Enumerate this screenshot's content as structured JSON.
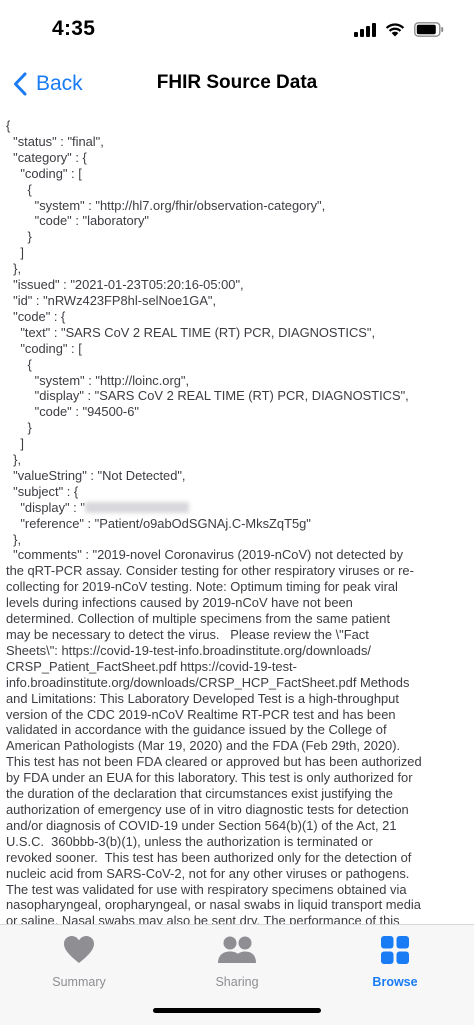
{
  "status_bar": {
    "time": "4:35"
  },
  "nav": {
    "back_label": "Back",
    "title": "FHIR Source Data"
  },
  "json_lines": [
    "{",
    "  \"status\" : \"final\",",
    "  \"category\" : {",
    "    \"coding\" : [",
    "      {",
    "        \"system\" : \"http://hl7.org/fhir/observation-category\",",
    "        \"code\" : \"laboratory\"",
    "      }",
    "    ]",
    "  },",
    "  \"issued\" : \"2021-01-23T05:20:16-05:00\",",
    "  \"id\" : \"nRWz423FP8hl-selNoe1GA\",",
    "  \"code\" : {",
    "    \"text\" : \"SARS CoV 2 REAL TIME (RT) PCR, DIAGNOSTICS\",",
    "    \"coding\" : [",
    "      {",
    "        \"system\" : \"http://loinc.org\",",
    "        \"display\" : \"SARS CoV 2 REAL TIME (RT) PCR, DIAGNOSTICS\",",
    "        \"code\" : \"94500-6\"",
    "      }",
    "    ]",
    "  },",
    "  \"valueString\" : \"Not Detected\",",
    "  \"subject\" : {"
  ],
  "subject_display_prefix": "    \"display\" : \"",
  "json_lines_after": [
    "    \"reference\" : \"Patient/o9abOdSGNAj.C-MksZqT5g\"",
    "  },"
  ],
  "comments_lines": [
    "  \"comments\" : \"2019-novel Coronavirus (2019-nCoV) not detected by",
    "the qRT-PCR assay. Consider testing for other respiratory viruses or re-",
    "collecting for 2019-nCoV testing. Note: Optimum timing for peak viral",
    "levels during infections caused by 2019-nCoV have not been",
    "determined. Collection of multiple specimens from the same patient",
    "may be necessary to detect the virus.   Please review the \\\"Fact",
    "Sheets\\\": https://covid-19-test-info.broadinstitute.org/downloads/",
    "CRSP_Patient_FactSheet.pdf https://covid-19-test-",
    "info.broadinstitute.org/downloads/CRSP_HCP_FactSheet.pdf Methods",
    "and Limitations: This Laboratory Developed Test is a high-throughput",
    "version of the CDC 2019-nCoV Realtime RT-PCR test and has been",
    "validated in accordance with the guidance issued by the College of",
    "American Pathologists (Mar 19, 2020) and the FDA (Feb 29th, 2020).",
    "This test has not been FDA cleared or approved but has been authorized",
    "by FDA under an EUA for this laboratory. This test is only authorized for",
    "the duration of the declaration that circumstances exist justifying the",
    "authorization of emergency use of in vitro diagnostic tests for detection",
    "and/or diagnosis of COVID-19 under Section 564(b)(1) of the Act, 21",
    "U.S.C.  360bbb-3(b)(1), unless the authorization is terminated or",
    "revoked sooner.  This test has been authorized only for the detection of",
    "nucleic acid from SARS-CoV-2, not for any other viruses or pathogens.",
    "The test was validated for use with respiratory specimens obtained via",
    "nasopharyngeal, oropharyngeal, or nasal swabs in liquid transport media",
    "or saline. Nasal swabs may also be sent dry. The performance of this"
  ],
  "tabs": [
    {
      "label": "Summary",
      "icon": "heart-icon",
      "active": false
    },
    {
      "label": "Sharing",
      "icon": "people-icon",
      "active": false
    },
    {
      "label": "Browse",
      "icon": "grid-icon",
      "active": true
    }
  ],
  "colors": {
    "accent": "#1a7cf5",
    "inactive": "#8e8e93",
    "text": "#3c3c43"
  }
}
